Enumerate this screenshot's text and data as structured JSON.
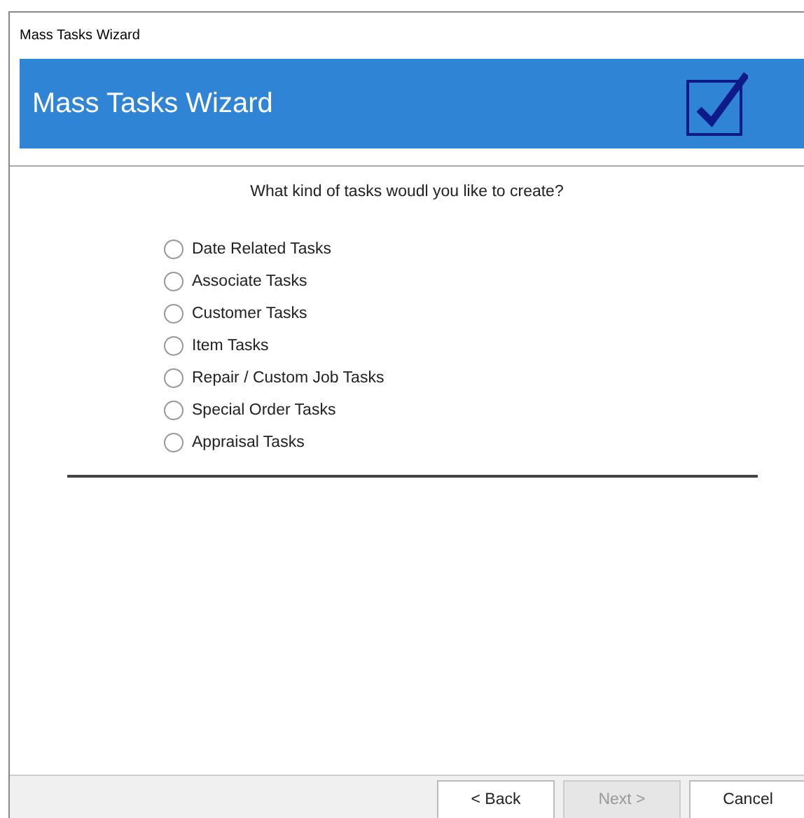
{
  "window": {
    "title": "Mass Tasks Wizard"
  },
  "banner": {
    "title": "Mass Tasks Wizard"
  },
  "question": "What kind of tasks woudl you like to create?",
  "options": [
    {
      "label": "Date Related Tasks",
      "selected": false
    },
    {
      "label": "Associate Tasks",
      "selected": false
    },
    {
      "label": "Customer Tasks",
      "selected": false
    },
    {
      "label": "Item Tasks",
      "selected": false
    },
    {
      "label": "Repair / Custom Job Tasks",
      "selected": false
    },
    {
      "label": "Special Order Tasks",
      "selected": false
    },
    {
      "label": "Appraisal Tasks",
      "selected": false
    }
  ],
  "buttons": [
    {
      "label": "< Back",
      "disabled": false
    },
    {
      "label": "Next >",
      "disabled": true
    },
    {
      "label": "Cancel",
      "disabled": false
    }
  ]
}
